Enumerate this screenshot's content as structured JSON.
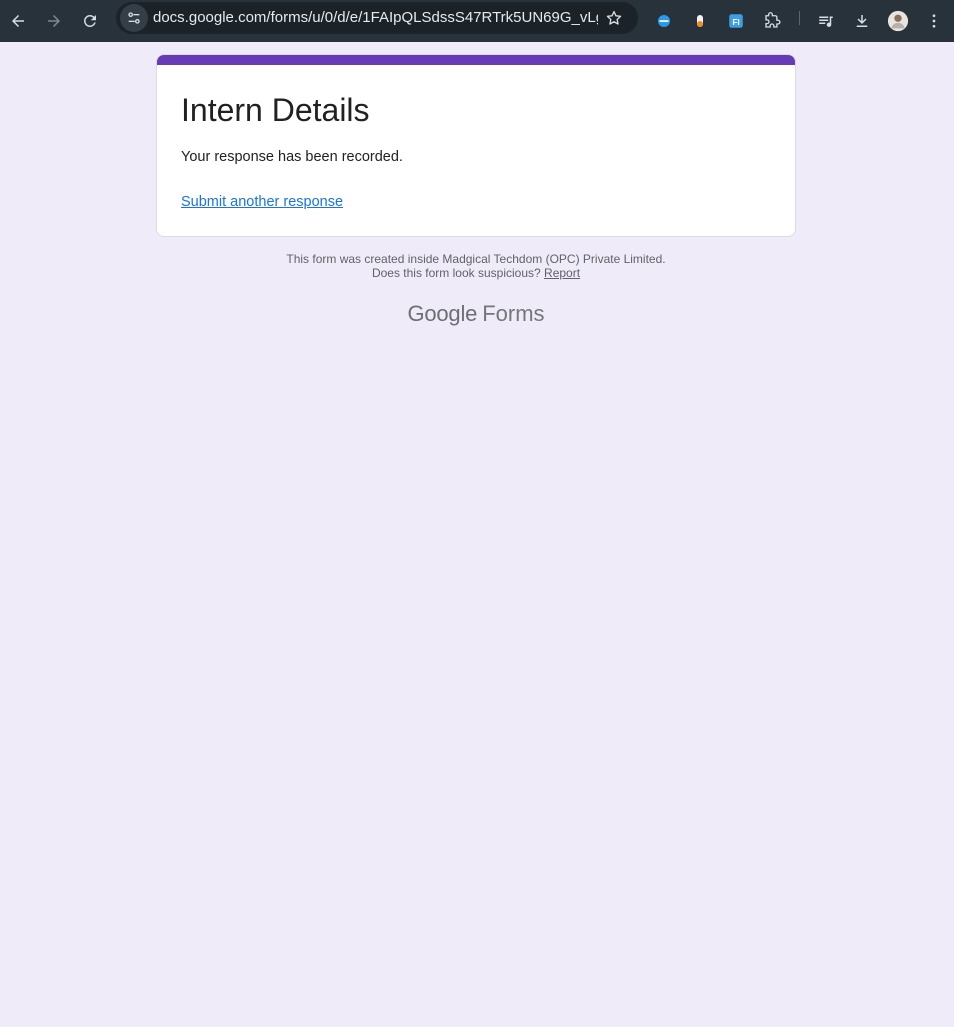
{
  "browser": {
    "url": "docs.google.com/forms/u/0/d/e/1FAIpQLSdssS47RTrk5UN69G_vLg9..."
  },
  "form": {
    "title": "Intern Details",
    "message": "Your response has been recorded.",
    "another_link": "Submit another response",
    "accent_color": "#673ab7"
  },
  "footer": {
    "line1": "This form was created inside Madgical Techdom (OPC) Private Limited.",
    "line2_prefix": "Does this form look suspicious?",
    "report_link": "Report"
  },
  "brand": {
    "google": "Google",
    "forms": "Forms"
  },
  "icons": {
    "back": "back-arrow-icon",
    "forward": "forward-arrow-icon",
    "reload": "reload-icon",
    "site_info": "site-info-icon",
    "bookmark": "star-icon",
    "extensions": [
      "blue-circle-extension-icon",
      "orange-capsule-extension-icon",
      "fi-extension-icon",
      "puzzle-icon"
    ],
    "media": "media-queue-icon",
    "download": "download-icon",
    "profile": "avatar",
    "menu": "kebab-menu-icon"
  }
}
